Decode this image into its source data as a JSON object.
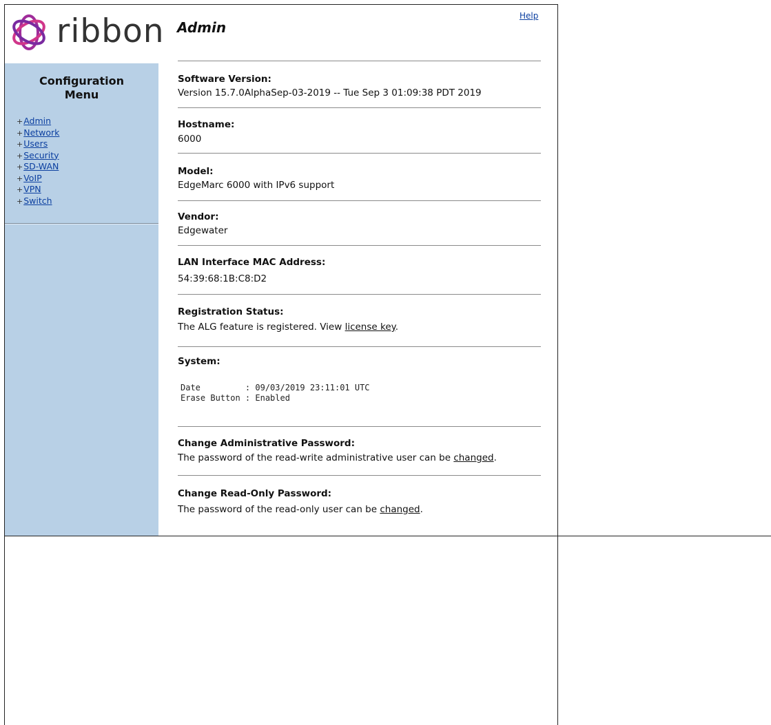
{
  "brand": {
    "logo_text": "ribbon",
    "logo_color": "#c8328c"
  },
  "header": {
    "title": "Admin",
    "help_label": "Help"
  },
  "sidebar": {
    "title": "Configuration\nMenu",
    "items": [
      {
        "label": "Admin"
      },
      {
        "label": "Network"
      },
      {
        "label": "Users"
      },
      {
        "label": "Security"
      },
      {
        "label": "SD-WAN"
      },
      {
        "label": "VoIP"
      },
      {
        "label": "VPN"
      },
      {
        "label": "Switch"
      }
    ]
  },
  "sections": {
    "software": {
      "label": "Software Version:",
      "value": "Version 15.7.0AlphaSep-03-2019 -- Tue Sep 3 01:09:38 PDT 2019"
    },
    "hostname": {
      "label": "Hostname:",
      "value": "6000"
    },
    "model": {
      "label": "Model:",
      "value": "EdgeMarc 6000 with IPv6 support"
    },
    "vendor": {
      "label": "Vendor:",
      "value": "Edgewater"
    },
    "mac": {
      "label": "LAN Interface MAC Address:",
      "value": "54:39:68:1B:C8:D2"
    },
    "registration": {
      "label": "Registration Status:",
      "text": "The ALG feature is registered. View ",
      "link": "license key",
      "suffix": "."
    },
    "system": {
      "label": "System:",
      "date_line": "Date         : 09/03/2019 23:11:01 UTC",
      "erase_line": "Erase Button : Enabled"
    },
    "admin_pw": {
      "label": "Change Administrative Password:",
      "text": "The password of the read-write administrative user can be ",
      "link": "changed",
      "suffix": "."
    },
    "ro_pw": {
      "label": "Change Read-Only Password:",
      "text": "The password of the read-only user can be ",
      "link": "changed",
      "suffix": "."
    }
  }
}
